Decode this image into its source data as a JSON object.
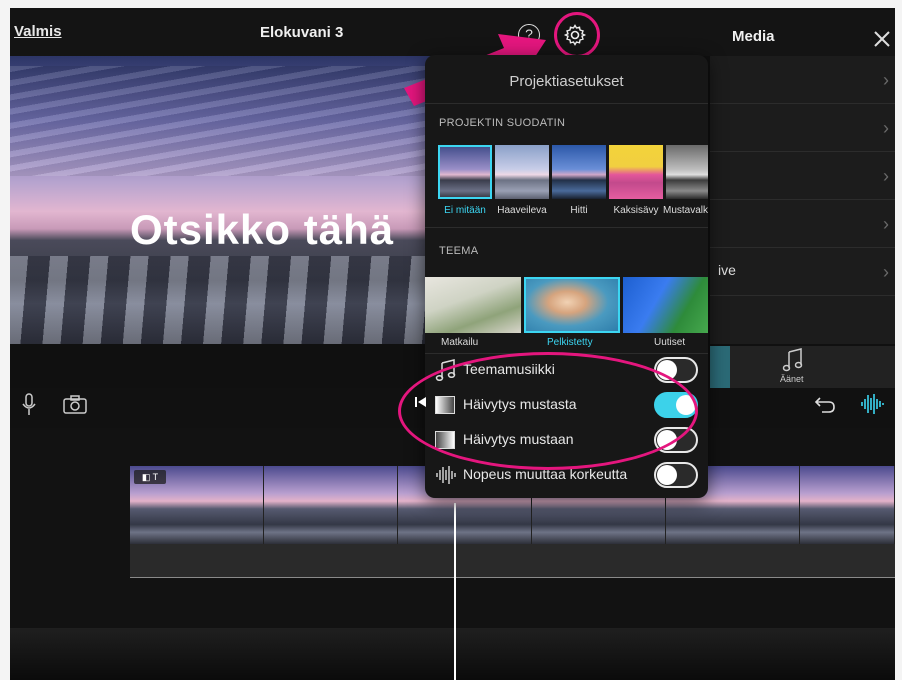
{
  "topbar": {
    "done_label": "Valmis",
    "project_title": "Elokuvani 3",
    "help_glyph": "?",
    "media_title": "Media",
    "icons": [
      "question-icon",
      "gear-icon",
      "close-icon"
    ]
  },
  "preview": {
    "title_text": "Otsikko tähä"
  },
  "media_panel": {
    "partial_item": "ive",
    "sound_tab_label": "Äänet"
  },
  "settings": {
    "title": "Projektiasetukset",
    "filter_section": "PROJEKTIN SUODATIN",
    "filters": [
      {
        "label": "Ei mitään",
        "selected": true
      },
      {
        "label": "Haaveileva",
        "selected": false
      },
      {
        "label": "Hitti",
        "selected": false
      },
      {
        "label": "Kaksisävy",
        "selected": false
      },
      {
        "label": "Mustavalk",
        "selected": false
      }
    ],
    "theme_section": "TEEMA",
    "themes": [
      {
        "label": "Matkailu",
        "selected": false
      },
      {
        "label": "Pelkistetty",
        "selected": true
      },
      {
        "label": "Uutiset",
        "selected": false
      }
    ],
    "options": [
      {
        "label": "Teemamusiikki",
        "on": false,
        "icon": "music-note-icon"
      },
      {
        "label": "Häivytys mustasta",
        "on": true,
        "icon": "fade-in-icon"
      },
      {
        "label": "Häivytys mustaan",
        "on": false,
        "icon": "fade-out-icon"
      },
      {
        "label": "Nopeus muuttaa korkeutta",
        "on": false,
        "icon": "waveform-icon"
      }
    ]
  },
  "timeline": {
    "clip_badge": "◧ T"
  },
  "colors": {
    "accent": "#3cd6f2",
    "annotation": "#e4167e"
  }
}
